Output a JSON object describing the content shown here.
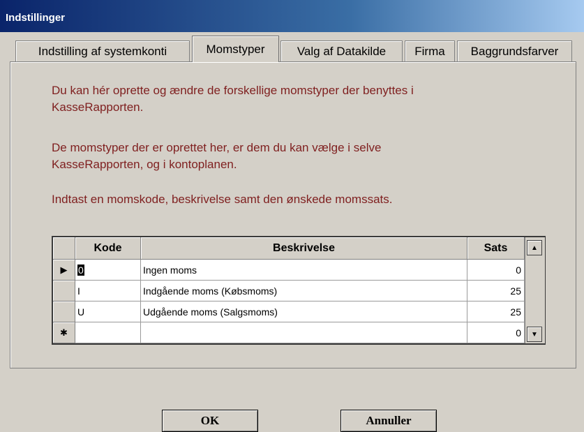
{
  "window": {
    "title": "Indstillinger"
  },
  "tabs": [
    {
      "label": "Indstilling af systemkonti"
    },
    {
      "label": "Momstyper"
    },
    {
      "label": "Valg af Datakilde"
    },
    {
      "label": "Firma"
    },
    {
      "label": "Baggrundsfarver"
    }
  ],
  "active_tab": "Momstyper",
  "instructions": {
    "p1_line1": "Du kan hér oprette og ændre de forskellige momstyper der benyttes i",
    "p1_line2": "KasseRapporten.",
    "p2_line1": "De momstyper der er oprettet her, er dem du kan vælge i selve",
    "p2_line2": "KasseRapporten, og i kontoplanen.",
    "p3_line1": "Indtast en momskode, beskrivelse samt den ønskede momssats."
  },
  "table": {
    "headers": {
      "kode": "Kode",
      "beskrivelse": "Beskrivelse",
      "sats": "Sats"
    },
    "rows": [
      {
        "kode": "0",
        "beskrivelse": "Ingen moms",
        "sats": "0"
      },
      {
        "kode": "I",
        "beskrivelse": "Indgående moms (Købsmoms)",
        "sats": "25"
      },
      {
        "kode": "U",
        "beskrivelse": "Udgående moms (Salgsmoms)",
        "sats": "25"
      },
      {
        "kode": "",
        "beskrivelse": "",
        "sats": "0"
      }
    ],
    "row_markers": {
      "current": "▶",
      "new": "✱"
    }
  },
  "buttons": {
    "ok": "OK",
    "cancel": "Annuller"
  },
  "icons": {
    "scroll_up": "▲",
    "scroll_down": "▼"
  },
  "colors": {
    "instruction_text": "#7f1f1f",
    "titlebar": "#0a246a"
  }
}
